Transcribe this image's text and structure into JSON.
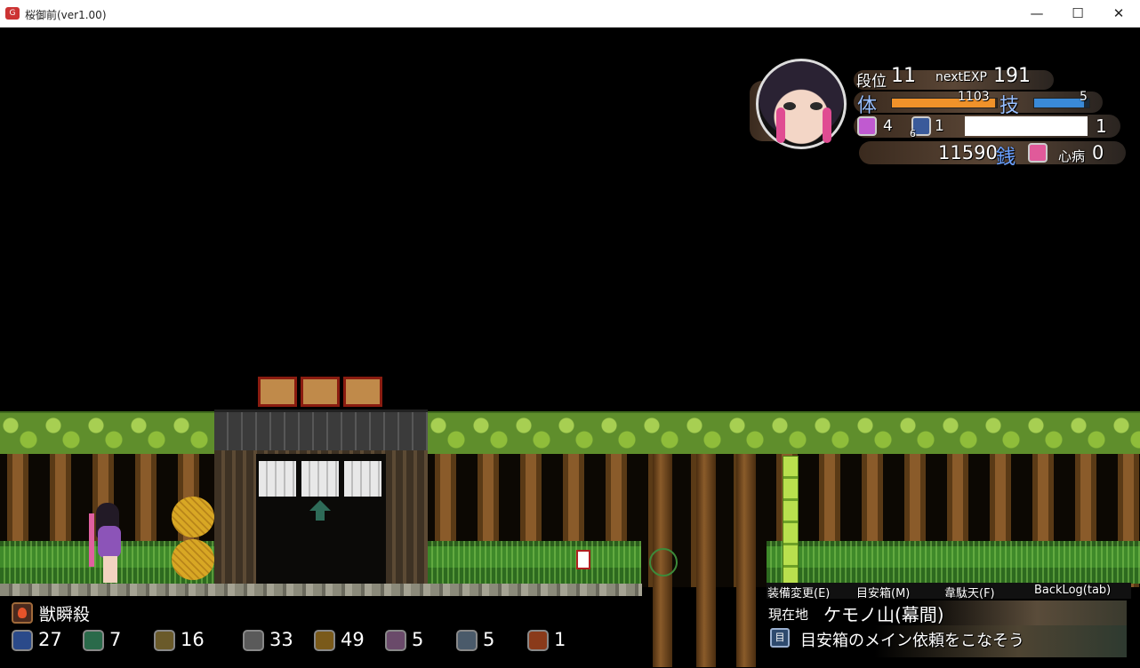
{
  "window": {
    "title": "桜御前(ver1.00)",
    "minimize_glyph": "—",
    "maximize_glyph": "☐",
    "close_glyph": "✕"
  },
  "status": {
    "level_label": "段位",
    "level": "11",
    "next_exp_label": "nextEXP",
    "next_exp": "191",
    "hp_label": "体",
    "hp_value": "1103",
    "hp_fraction": 0.98,
    "skill_label": "技",
    "skill_value": "5",
    "skill_fraction": 0.9,
    "stat_a": "4",
    "stat_a_sub": "6",
    "stat_b": "1",
    "stat_c": "1",
    "money": "11590",
    "money_label": "銭",
    "sickness_label": "心病",
    "sickness": "0"
  },
  "skill": {
    "name": "獣瞬殺",
    "icon": "fire-icon"
  },
  "inventory": [
    {
      "icon": "water-drop-icon",
      "count": "27"
    },
    {
      "icon": "music-note-icon",
      "count": "7"
    },
    {
      "icon": "cookie-icon",
      "count": "16"
    },
    {
      "icon": "bone-icon",
      "count": "33"
    },
    {
      "icon": "seed-icon",
      "count": "49"
    },
    {
      "icon": "rabbit-icon",
      "count": "5"
    },
    {
      "icon": "wolf-icon",
      "count": "5"
    },
    {
      "icon": "fox-icon",
      "count": "1"
    }
  ],
  "menu": {
    "equip": "装備変更(E)",
    "suggestion_box": "目安箱(M)",
    "idaten": "韋駄天(F)",
    "backlog": "BackLog(tab)"
  },
  "location": {
    "label": "現在地",
    "name": "ケモノ山(幕間)"
  },
  "quest": {
    "text": "目安箱のメイン依頼をこなそう"
  },
  "colors": {
    "hp_bar": "#f0922a",
    "skill_bar": "#3a8ad8",
    "money_accent": "#6aa0ff"
  }
}
